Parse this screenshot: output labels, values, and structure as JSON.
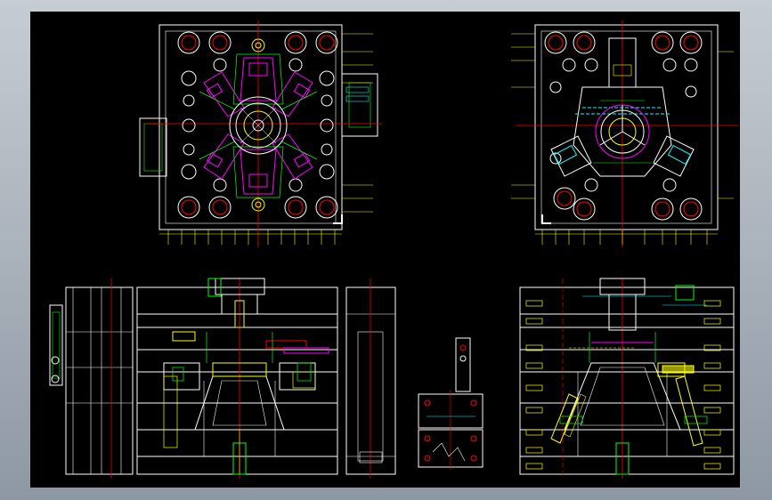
{
  "colors": {
    "background": "#000000",
    "outline": "#ffffff",
    "dimension": "#ffff00",
    "center": "#ff0000",
    "slider": "#ff00ff",
    "cooling": "#00ff00",
    "part": "#00ffff"
  },
  "views": [
    {
      "name": "top-left-plan-view"
    },
    {
      "name": "top-right-plan-view"
    },
    {
      "name": "bottom-left-section-view"
    },
    {
      "name": "bottom-middle-detail-view"
    },
    {
      "name": "bottom-right-section-view"
    }
  ]
}
